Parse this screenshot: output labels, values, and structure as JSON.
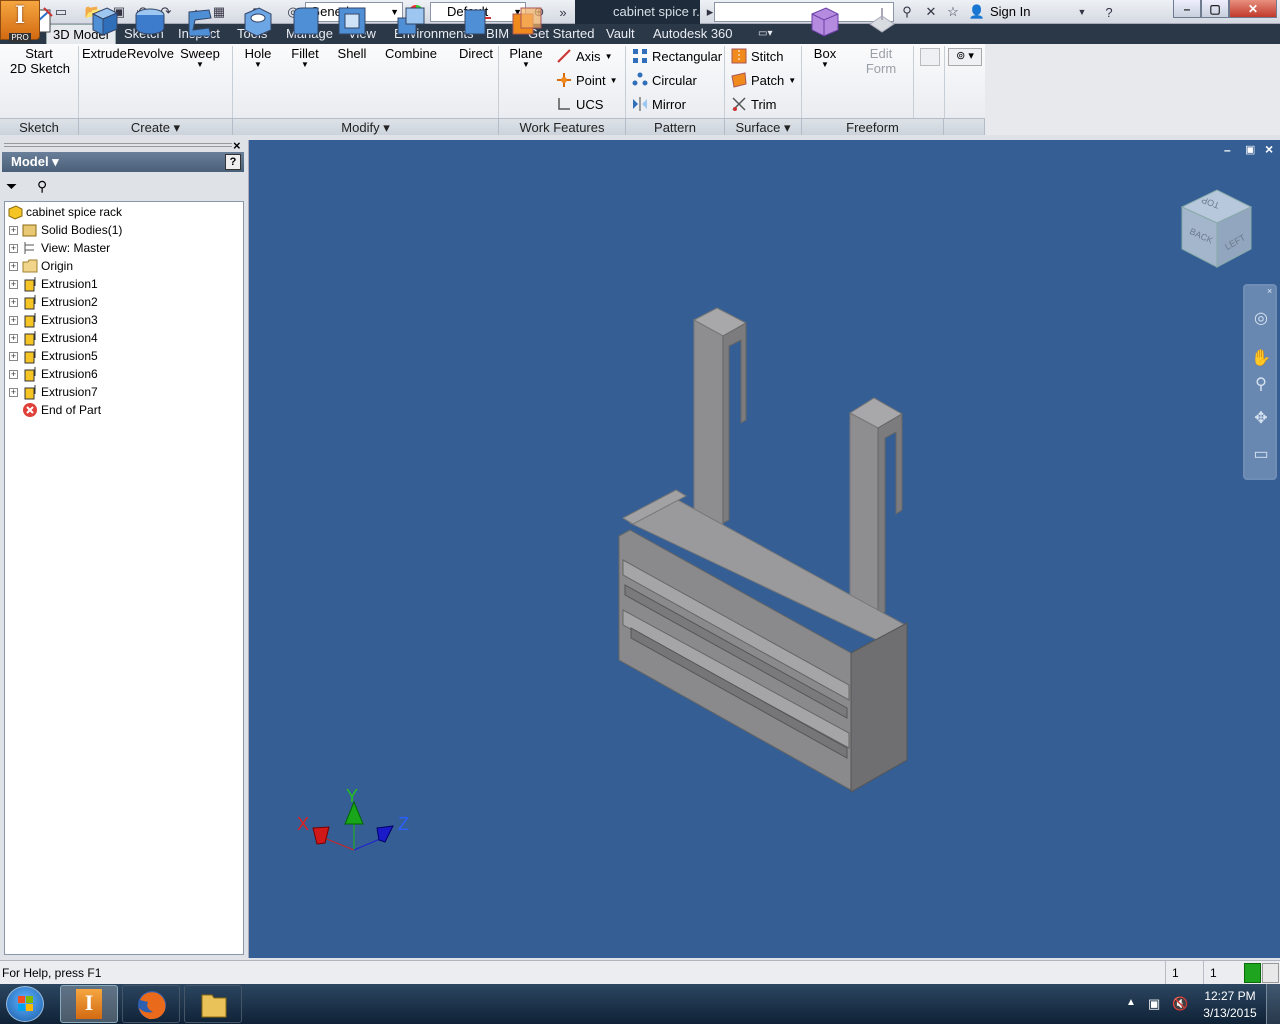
{
  "titlebar": {
    "appearance_dropdown": "Generic",
    "style_dropdown": "Default",
    "document_tab": "cabinet spice r...",
    "sign_in": "Sign In",
    "app_badge": "PRO",
    "app_letter": "I"
  },
  "menu_tabs": [
    "3D Model",
    "Sketch",
    "Inspect",
    "Tools",
    "Manage",
    "View",
    "Environments",
    "BIM",
    "Get Started",
    "Vault",
    "Autodesk 360"
  ],
  "active_tab": "3D Model",
  "ribbon": {
    "sketch": {
      "start_line1": "Start",
      "start_line2": "2D Sketch"
    },
    "create": {
      "extrude": "Extrude",
      "revolve": "Revolve",
      "sweep": "Sweep"
    },
    "modify": {
      "hole": "Hole",
      "fillet": "Fillet",
      "shell": "Shell",
      "combine": "Combine",
      "direct": "Direct"
    },
    "work_features": {
      "plane": "Plane",
      "axis": "Axis",
      "point": "Point",
      "ucs": "UCS"
    },
    "pattern": {
      "rectangular": "Rectangular",
      "circular": "Circular",
      "mirror": "Mirror"
    },
    "surface": {
      "stitch": "Stitch",
      "patch": "Patch",
      "trim": "Trim"
    },
    "freeform": {
      "box": "Box",
      "edit_line1": "Edit",
      "edit_line2": "Form"
    },
    "panels": {
      "sketch": "Sketch",
      "create": "Create",
      "modify": "Modify",
      "work_features": "Work Features",
      "pattern": "Pattern",
      "surface": "Surface",
      "freeform": "Freeform"
    }
  },
  "browser": {
    "header": "Model",
    "root": "cabinet spice rack",
    "items": [
      "Solid Bodies(1)",
      "View: Master",
      "Origin",
      "Extrusion1",
      "Extrusion2",
      "Extrusion3",
      "Extrusion4",
      "Extrusion5",
      "Extrusion6",
      "Extrusion7",
      "End of Part"
    ]
  },
  "viewcube": {
    "top": "TOP",
    "back": "BACK",
    "left": "LEFT"
  },
  "triad": {
    "x": "X",
    "y": "Y",
    "z": "Z"
  },
  "status": {
    "help": "For Help, press F1",
    "count1": "1",
    "count2": "1"
  },
  "taskbar": {
    "time": "12:27 PM",
    "date": "3/13/2015"
  },
  "colors": {
    "viewport": "#355f94",
    "model_gray": "#8e8e90",
    "accent": "#f08a1c"
  }
}
